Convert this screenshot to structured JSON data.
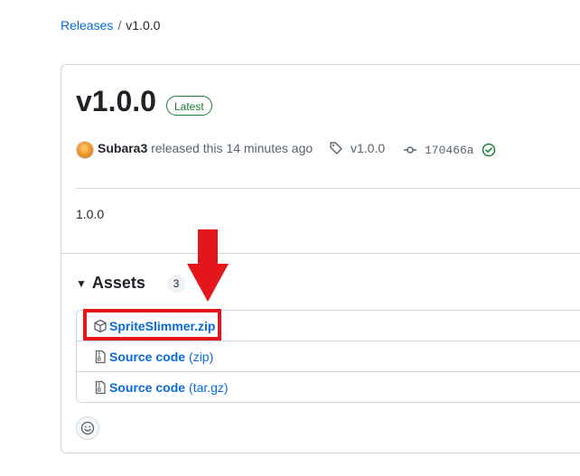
{
  "breadcrumb": {
    "parent": "Releases",
    "separator": "/",
    "current": "v1.0.0"
  },
  "release": {
    "title": "v1.0.0",
    "badge": "Latest",
    "author": "Subara3",
    "released_text": "released this 14 minutes ago",
    "tag": "v1.0.0",
    "commit": "170466a",
    "body": "1.0.0"
  },
  "assets": {
    "label": "Assets",
    "count": "3",
    "items": [
      {
        "name": "SpriteSlimmer.zip",
        "suffix": "",
        "icon": "package-icon"
      },
      {
        "name": "Source code",
        "suffix": "(zip)",
        "icon": "file-zip-icon"
      },
      {
        "name": "Source code",
        "suffix": "(tar.gz)",
        "icon": "file-zip-icon"
      }
    ]
  },
  "colors": {
    "link": "#0969da",
    "success": "#1a7f37",
    "annotation": "#e4161c"
  }
}
